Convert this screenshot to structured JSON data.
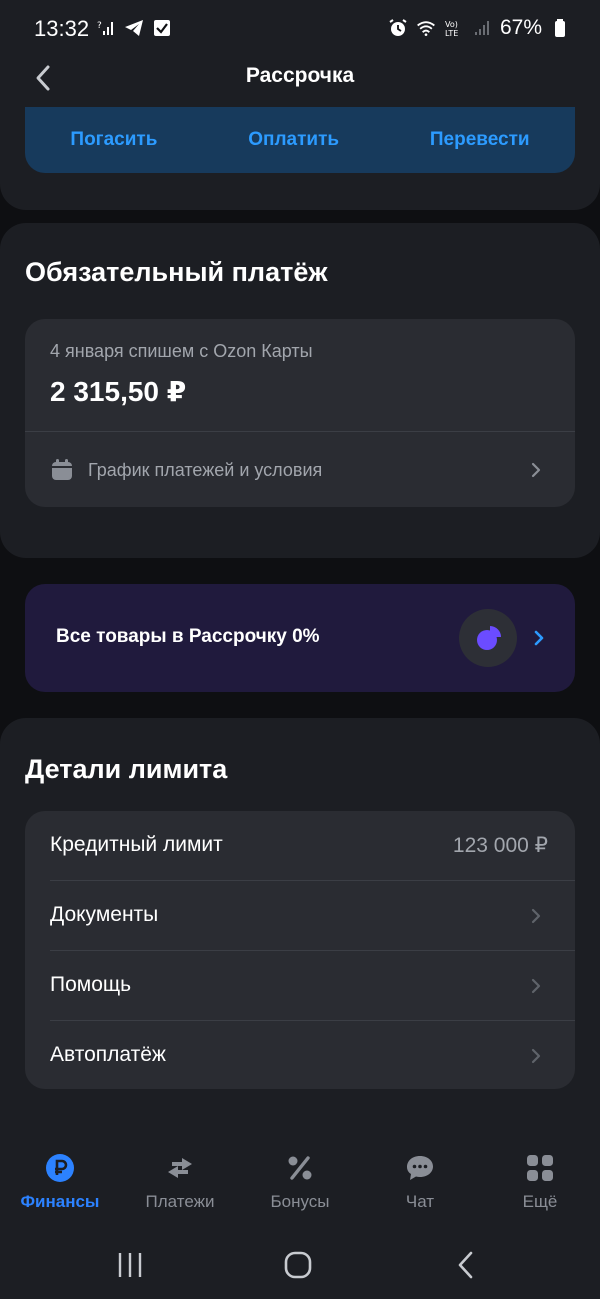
{
  "status_bar": {
    "time": "13:32",
    "battery": "67%"
  },
  "header": {
    "title": "Рассрочка"
  },
  "quick_actions": [
    {
      "label": "Погасить"
    },
    {
      "label": "Оплатить"
    },
    {
      "label": "Перевести"
    }
  ],
  "mandatory_payment": {
    "title": "Обязательный платёж",
    "caption": "4 января спишем с Ozon Карты",
    "amount": "2 315,50 ₽",
    "schedule_label": "График платежей и условия"
  },
  "promo": {
    "text": "Все товары в Рассрочку 0%"
  },
  "limit_details": {
    "title": "Детали лимита",
    "rows": [
      {
        "label": "Кредитный лимит",
        "value": "123 000 ₽"
      },
      {
        "label": "Документы"
      },
      {
        "label": "Помощь"
      },
      {
        "label": "Автоплатёж"
      }
    ]
  },
  "bottom_nav": [
    {
      "label": "Финансы",
      "icon": "ruble-icon",
      "active": true
    },
    {
      "label": "Платежи",
      "icon": "transfer-arrows-icon",
      "active": false
    },
    {
      "label": "Бонусы",
      "icon": "percent-icon",
      "active": false
    },
    {
      "label": "Чат",
      "icon": "chat-icon",
      "active": false
    },
    {
      "label": "Ещё",
      "icon": "grid-icon",
      "active": false
    }
  ],
  "colors": {
    "accent": "#2c82ff",
    "link": "#2c9bff",
    "card": "#1c1e23",
    "inner_card": "#2a2c32",
    "promo": "#201a3d",
    "promo_icon": "#6b4cff"
  }
}
